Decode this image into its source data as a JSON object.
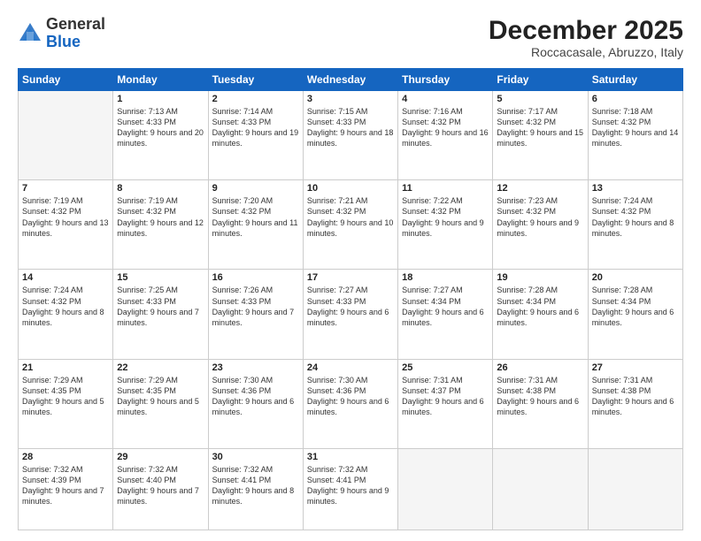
{
  "header": {
    "logo_general": "General",
    "logo_blue": "Blue",
    "month": "December 2025",
    "location": "Roccacasale, Abruzzo, Italy"
  },
  "days_of_week": [
    "Sunday",
    "Monday",
    "Tuesday",
    "Wednesday",
    "Thursday",
    "Friday",
    "Saturday"
  ],
  "weeks": [
    [
      {
        "day": "",
        "empty": true
      },
      {
        "day": "1",
        "sunrise": "Sunrise: 7:13 AM",
        "sunset": "Sunset: 4:33 PM",
        "daylight": "Daylight: 9 hours and 20 minutes."
      },
      {
        "day": "2",
        "sunrise": "Sunrise: 7:14 AM",
        "sunset": "Sunset: 4:33 PM",
        "daylight": "Daylight: 9 hours and 19 minutes."
      },
      {
        "day": "3",
        "sunrise": "Sunrise: 7:15 AM",
        "sunset": "Sunset: 4:33 PM",
        "daylight": "Daylight: 9 hours and 18 minutes."
      },
      {
        "day": "4",
        "sunrise": "Sunrise: 7:16 AM",
        "sunset": "Sunset: 4:32 PM",
        "daylight": "Daylight: 9 hours and 16 minutes."
      },
      {
        "day": "5",
        "sunrise": "Sunrise: 7:17 AM",
        "sunset": "Sunset: 4:32 PM",
        "daylight": "Daylight: 9 hours and 15 minutes."
      },
      {
        "day": "6",
        "sunrise": "Sunrise: 7:18 AM",
        "sunset": "Sunset: 4:32 PM",
        "daylight": "Daylight: 9 hours and 14 minutes."
      }
    ],
    [
      {
        "day": "7",
        "sunrise": "Sunrise: 7:19 AM",
        "sunset": "Sunset: 4:32 PM",
        "daylight": "Daylight: 9 hours and 13 minutes."
      },
      {
        "day": "8",
        "sunrise": "Sunrise: 7:19 AM",
        "sunset": "Sunset: 4:32 PM",
        "daylight": "Daylight: 9 hours and 12 minutes."
      },
      {
        "day": "9",
        "sunrise": "Sunrise: 7:20 AM",
        "sunset": "Sunset: 4:32 PM",
        "daylight": "Daylight: 9 hours and 11 minutes."
      },
      {
        "day": "10",
        "sunrise": "Sunrise: 7:21 AM",
        "sunset": "Sunset: 4:32 PM",
        "daylight": "Daylight: 9 hours and 10 minutes."
      },
      {
        "day": "11",
        "sunrise": "Sunrise: 7:22 AM",
        "sunset": "Sunset: 4:32 PM",
        "daylight": "Daylight: 9 hours and 9 minutes."
      },
      {
        "day": "12",
        "sunrise": "Sunrise: 7:23 AM",
        "sunset": "Sunset: 4:32 PM",
        "daylight": "Daylight: 9 hours and 9 minutes."
      },
      {
        "day": "13",
        "sunrise": "Sunrise: 7:24 AM",
        "sunset": "Sunset: 4:32 PM",
        "daylight": "Daylight: 9 hours and 8 minutes."
      }
    ],
    [
      {
        "day": "14",
        "sunrise": "Sunrise: 7:24 AM",
        "sunset": "Sunset: 4:32 PM",
        "daylight": "Daylight: 9 hours and 8 minutes."
      },
      {
        "day": "15",
        "sunrise": "Sunrise: 7:25 AM",
        "sunset": "Sunset: 4:33 PM",
        "daylight": "Daylight: 9 hours and 7 minutes."
      },
      {
        "day": "16",
        "sunrise": "Sunrise: 7:26 AM",
        "sunset": "Sunset: 4:33 PM",
        "daylight": "Daylight: 9 hours and 7 minutes."
      },
      {
        "day": "17",
        "sunrise": "Sunrise: 7:27 AM",
        "sunset": "Sunset: 4:33 PM",
        "daylight": "Daylight: 9 hours and 6 minutes."
      },
      {
        "day": "18",
        "sunrise": "Sunrise: 7:27 AM",
        "sunset": "Sunset: 4:34 PM",
        "daylight": "Daylight: 9 hours and 6 minutes."
      },
      {
        "day": "19",
        "sunrise": "Sunrise: 7:28 AM",
        "sunset": "Sunset: 4:34 PM",
        "daylight": "Daylight: 9 hours and 6 minutes."
      },
      {
        "day": "20",
        "sunrise": "Sunrise: 7:28 AM",
        "sunset": "Sunset: 4:34 PM",
        "daylight": "Daylight: 9 hours and 6 minutes."
      }
    ],
    [
      {
        "day": "21",
        "sunrise": "Sunrise: 7:29 AM",
        "sunset": "Sunset: 4:35 PM",
        "daylight": "Daylight: 9 hours and 5 minutes."
      },
      {
        "day": "22",
        "sunrise": "Sunrise: 7:29 AM",
        "sunset": "Sunset: 4:35 PM",
        "daylight": "Daylight: 9 hours and 5 minutes."
      },
      {
        "day": "23",
        "sunrise": "Sunrise: 7:30 AM",
        "sunset": "Sunset: 4:36 PM",
        "daylight": "Daylight: 9 hours and 6 minutes."
      },
      {
        "day": "24",
        "sunrise": "Sunrise: 7:30 AM",
        "sunset": "Sunset: 4:36 PM",
        "daylight": "Daylight: 9 hours and 6 minutes."
      },
      {
        "day": "25",
        "sunrise": "Sunrise: 7:31 AM",
        "sunset": "Sunset: 4:37 PM",
        "daylight": "Daylight: 9 hours and 6 minutes."
      },
      {
        "day": "26",
        "sunrise": "Sunrise: 7:31 AM",
        "sunset": "Sunset: 4:38 PM",
        "daylight": "Daylight: 9 hours and 6 minutes."
      },
      {
        "day": "27",
        "sunrise": "Sunrise: 7:31 AM",
        "sunset": "Sunset: 4:38 PM",
        "daylight": "Daylight: 9 hours and 6 minutes."
      }
    ],
    [
      {
        "day": "28",
        "sunrise": "Sunrise: 7:32 AM",
        "sunset": "Sunset: 4:39 PM",
        "daylight": "Daylight: 9 hours and 7 minutes."
      },
      {
        "day": "29",
        "sunrise": "Sunrise: 7:32 AM",
        "sunset": "Sunset: 4:40 PM",
        "daylight": "Daylight: 9 hours and 7 minutes."
      },
      {
        "day": "30",
        "sunrise": "Sunrise: 7:32 AM",
        "sunset": "Sunset: 4:41 PM",
        "daylight": "Daylight: 9 hours and 8 minutes."
      },
      {
        "day": "31",
        "sunrise": "Sunrise: 7:32 AM",
        "sunset": "Sunset: 4:41 PM",
        "daylight": "Daylight: 9 hours and 9 minutes."
      },
      {
        "day": "",
        "empty": true
      },
      {
        "day": "",
        "empty": true
      },
      {
        "day": "",
        "empty": true
      }
    ]
  ]
}
